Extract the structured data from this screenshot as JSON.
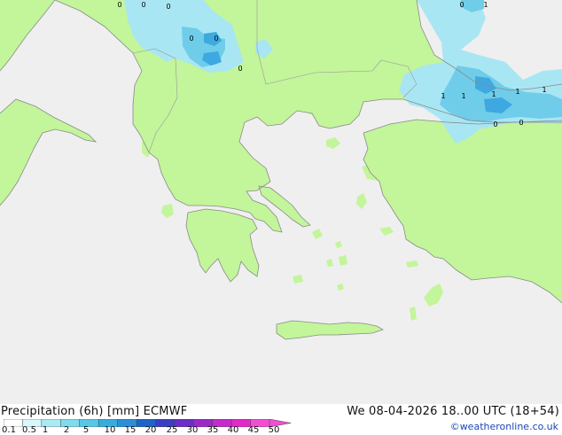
{
  "map": {
    "colors": {
      "sea": "#efefef",
      "land": "#c3f59b",
      "coast": "#8a8a8a",
      "precip_light": "#a9e6f3",
      "precip_mid": "#6fcdea",
      "precip_heavy": "#3ea9e0"
    },
    "contour_labels": [
      "0",
      "0",
      "0",
      "0",
      "0",
      "1",
      "0",
      "1",
      "1",
      "1",
      "1",
      "1",
      "0",
      "0",
      "0"
    ]
  },
  "footer": {
    "title": "Precipitation (6h) [mm] ECMWF",
    "datetime": "We 08-04-2026 18..00 UTC (18+54)",
    "credit": "©weatheronline.co.uk"
  },
  "legend": {
    "ticks": [
      "0.1",
      "0.5",
      "1",
      "2",
      "5",
      "10",
      "15",
      "20",
      "25",
      "30",
      "35",
      "40",
      "45",
      "50"
    ],
    "colors": [
      "#ffffff",
      "#d6f7fb",
      "#a9eaf5",
      "#7fdbee",
      "#55c8e6",
      "#35aede",
      "#2a8fd6",
      "#1d64c8",
      "#3a3fc2",
      "#6a2ec4",
      "#9a2ac8",
      "#c52acb",
      "#e22ac8",
      "#f24ed4"
    ]
  }
}
